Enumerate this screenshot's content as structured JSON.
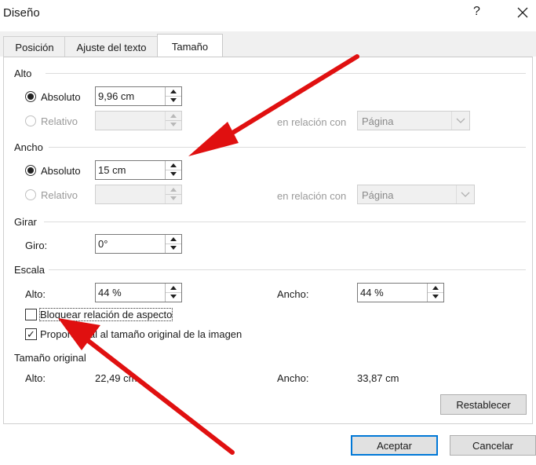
{
  "window": {
    "title": "Diseño",
    "help": "?",
    "close": "close"
  },
  "tabs": [
    {
      "label": "Posición",
      "active": false
    },
    {
      "label": "Ajuste del texto",
      "active": false
    },
    {
      "label": "Tamaño",
      "active": true
    }
  ],
  "alto": {
    "section": "Alto",
    "absoluto_label": "Absoluto",
    "absoluto_value": "9,96 cm",
    "relativo_label": "Relativo",
    "relativo_value": "",
    "relacion_label": "en relación con",
    "relacion_value": "Página"
  },
  "ancho": {
    "section": "Ancho",
    "absoluto_label": "Absoluto",
    "absoluto_value": "15 cm",
    "relativo_label": "Relativo",
    "relativo_value": "",
    "relacion_label": "en relación con",
    "relacion_value": "Página"
  },
  "girar": {
    "section": "Girar",
    "giro_label": "Giro:",
    "giro_value": "0°"
  },
  "escala": {
    "section": "Escala",
    "alto_label": "Alto:",
    "alto_value": "44 %",
    "ancho_label": "Ancho:",
    "ancho_value": "44 %",
    "bloquear_label": "Bloquear relación de aspecto",
    "bloquear_checked": false,
    "proporcional_label": "Proporcional al tamaño original de la imagen",
    "proporcional_checked": true
  },
  "original": {
    "section": "Tamaño original",
    "alto_label": "Alto:",
    "alto_value": "22,49 cm",
    "ancho_label": "Ancho:",
    "ancho_value": "33,87 cm"
  },
  "buttons": {
    "restablecer": "Restablecer",
    "aceptar": "Aceptar",
    "cancelar": "Cancelar"
  },
  "colors": {
    "accent": "#0078d7",
    "annotation": "#e01010"
  }
}
